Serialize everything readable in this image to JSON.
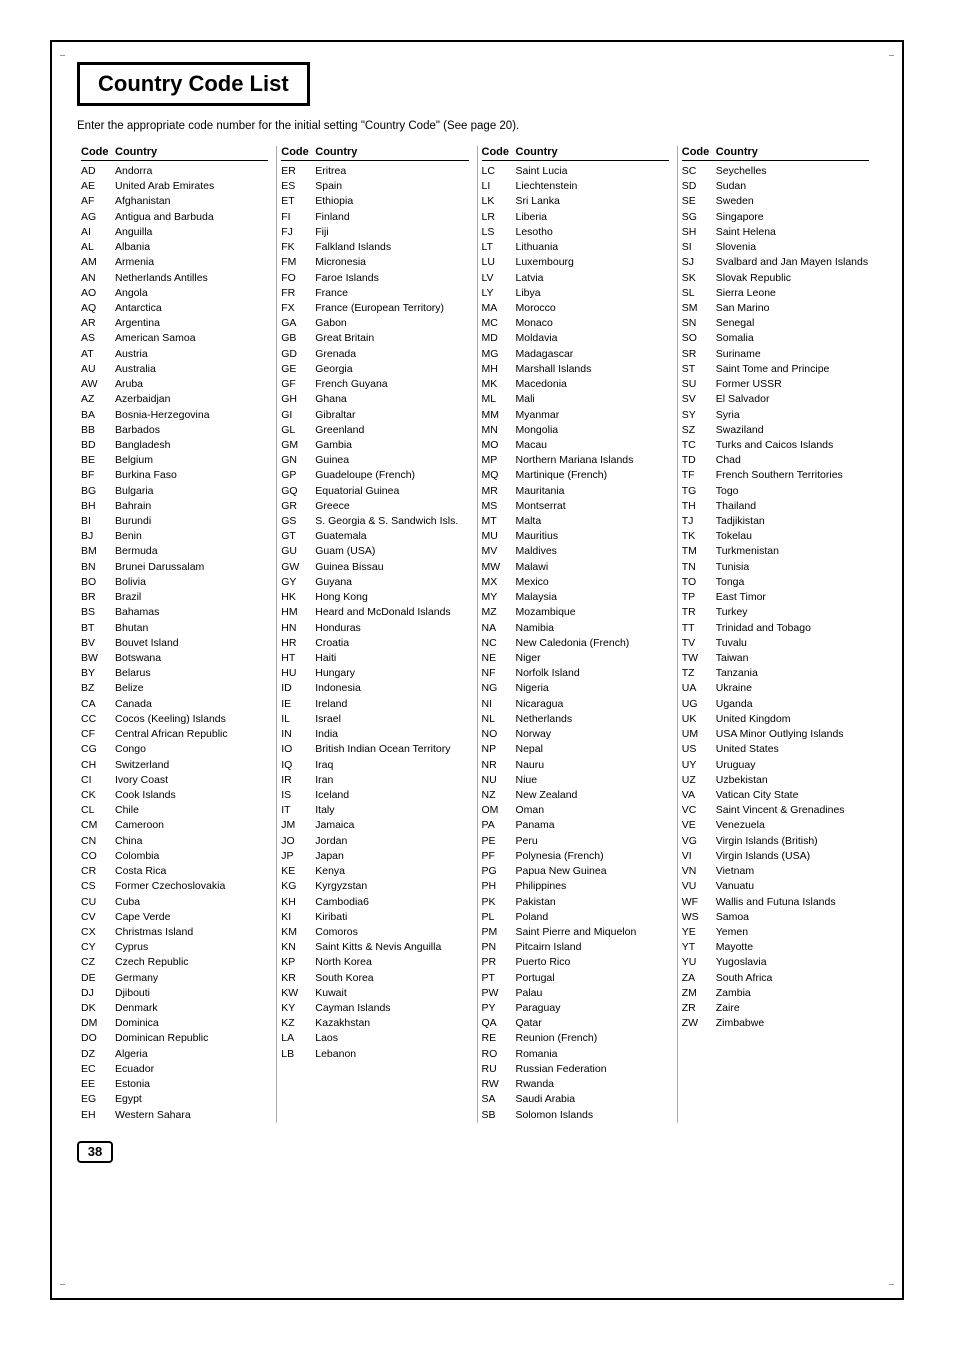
{
  "page": {
    "title": "Country Code List",
    "subtitle": "Enter the appropriate code number for the initial setting \"Country Code\" (See page 20).",
    "page_number": "38",
    "col_header": {
      "code": "Code",
      "country": "Country"
    }
  },
  "columns": [
    {
      "entries": [
        {
          "code": "AD",
          "country": "Andorra"
        },
        {
          "code": "AE",
          "country": "United Arab Emirates"
        },
        {
          "code": "AF",
          "country": "Afghanistan"
        },
        {
          "code": "AG",
          "country": "Antigua and Barbuda"
        },
        {
          "code": "AI",
          "country": "Anguilla"
        },
        {
          "code": "AL",
          "country": "Albania"
        },
        {
          "code": "AM",
          "country": "Armenia"
        },
        {
          "code": "AN",
          "country": "Netherlands Antilles"
        },
        {
          "code": "AO",
          "country": "Angola"
        },
        {
          "code": "AQ",
          "country": "Antarctica"
        },
        {
          "code": "AR",
          "country": "Argentina"
        },
        {
          "code": "AS",
          "country": "American Samoa"
        },
        {
          "code": "AT",
          "country": "Austria"
        },
        {
          "code": "AU",
          "country": "Australia"
        },
        {
          "code": "AW",
          "country": "Aruba"
        },
        {
          "code": "AZ",
          "country": "Azerbaidjan"
        },
        {
          "code": "BA",
          "country": "Bosnia-Herzegovina"
        },
        {
          "code": "BB",
          "country": "Barbados"
        },
        {
          "code": "BD",
          "country": "Bangladesh"
        },
        {
          "code": "BE",
          "country": "Belgium"
        },
        {
          "code": "BF",
          "country": "Burkina Faso"
        },
        {
          "code": "BG",
          "country": "Bulgaria"
        },
        {
          "code": "BH",
          "country": "Bahrain"
        },
        {
          "code": "BI",
          "country": "Burundi"
        },
        {
          "code": "BJ",
          "country": "Benin"
        },
        {
          "code": "BM",
          "country": "Bermuda"
        },
        {
          "code": "BN",
          "country": "Brunei Darussalam"
        },
        {
          "code": "BO",
          "country": "Bolivia"
        },
        {
          "code": "BR",
          "country": "Brazil"
        },
        {
          "code": "BS",
          "country": "Bahamas"
        },
        {
          "code": "BT",
          "country": "Bhutan"
        },
        {
          "code": "BV",
          "country": "Bouvet Island"
        },
        {
          "code": "BW",
          "country": "Botswana"
        },
        {
          "code": "BY",
          "country": "Belarus"
        },
        {
          "code": "BZ",
          "country": "Belize"
        },
        {
          "code": "CA",
          "country": "Canada"
        },
        {
          "code": "CC",
          "country": "Cocos (Keeling) Islands"
        },
        {
          "code": "CF",
          "country": "Central African Republic"
        },
        {
          "code": "CG",
          "country": "Congo"
        },
        {
          "code": "CH",
          "country": "Switzerland"
        },
        {
          "code": "CI",
          "country": "Ivory Coast"
        },
        {
          "code": "CK",
          "country": "Cook Islands"
        },
        {
          "code": "CL",
          "country": "Chile"
        },
        {
          "code": "CM",
          "country": "Cameroon"
        },
        {
          "code": "CN",
          "country": "China"
        },
        {
          "code": "CO",
          "country": "Colombia"
        },
        {
          "code": "CR",
          "country": "Costa Rica"
        },
        {
          "code": "CS",
          "country": "Former Czechoslovakia"
        },
        {
          "code": "CU",
          "country": "Cuba"
        },
        {
          "code": "CV",
          "country": "Cape Verde"
        },
        {
          "code": "CX",
          "country": "Christmas Island"
        },
        {
          "code": "CY",
          "country": "Cyprus"
        },
        {
          "code": "CZ",
          "country": "Czech Republic"
        },
        {
          "code": "DE",
          "country": "Germany"
        },
        {
          "code": "DJ",
          "country": "Djibouti"
        },
        {
          "code": "DK",
          "country": "Denmark"
        },
        {
          "code": "DM",
          "country": "Dominica"
        },
        {
          "code": "DO",
          "country": "Dominican Republic"
        },
        {
          "code": "DZ",
          "country": "Algeria"
        },
        {
          "code": "EC",
          "country": "Ecuador"
        },
        {
          "code": "EE",
          "country": "Estonia"
        },
        {
          "code": "EG",
          "country": "Egypt"
        },
        {
          "code": "EH",
          "country": "Western Sahara"
        }
      ]
    },
    {
      "entries": [
        {
          "code": "ER",
          "country": "Eritrea"
        },
        {
          "code": "ES",
          "country": "Spain"
        },
        {
          "code": "ET",
          "country": "Ethiopia"
        },
        {
          "code": "FI",
          "country": "Finland"
        },
        {
          "code": "FJ",
          "country": "Fiji"
        },
        {
          "code": "FK",
          "country": "Falkland Islands"
        },
        {
          "code": "FM",
          "country": "Micronesia"
        },
        {
          "code": "FO",
          "country": "Faroe Islands"
        },
        {
          "code": "FR",
          "country": "France"
        },
        {
          "code": "FX",
          "country": "France (European Territory)"
        },
        {
          "code": "GA",
          "country": "Gabon"
        },
        {
          "code": "GB",
          "country": "Great Britain"
        },
        {
          "code": "GD",
          "country": "Grenada"
        },
        {
          "code": "GE",
          "country": "Georgia"
        },
        {
          "code": "GF",
          "country": "French Guyana"
        },
        {
          "code": "GH",
          "country": "Ghana"
        },
        {
          "code": "GI",
          "country": "Gibraltar"
        },
        {
          "code": "GL",
          "country": "Greenland"
        },
        {
          "code": "GM",
          "country": "Gambia"
        },
        {
          "code": "GN",
          "country": "Guinea"
        },
        {
          "code": "GP",
          "country": "Guadeloupe (French)"
        },
        {
          "code": "GQ",
          "country": "Equatorial Guinea"
        },
        {
          "code": "GR",
          "country": "Greece"
        },
        {
          "code": "GS",
          "country": "S. Georgia & S. Sandwich Isls."
        },
        {
          "code": "GT",
          "country": "Guatemala"
        },
        {
          "code": "GU",
          "country": "Guam (USA)"
        },
        {
          "code": "GW",
          "country": "Guinea Bissau"
        },
        {
          "code": "GY",
          "country": "Guyana"
        },
        {
          "code": "HK",
          "country": "Hong Kong"
        },
        {
          "code": "HM",
          "country": "Heard and McDonald Islands"
        },
        {
          "code": "HN",
          "country": "Honduras"
        },
        {
          "code": "HR",
          "country": "Croatia"
        },
        {
          "code": "HT",
          "country": "Haiti"
        },
        {
          "code": "HU",
          "country": "Hungary"
        },
        {
          "code": "ID",
          "country": "Indonesia"
        },
        {
          "code": "IE",
          "country": "Ireland"
        },
        {
          "code": "IL",
          "country": "Israel"
        },
        {
          "code": "IN",
          "country": "India"
        },
        {
          "code": "IO",
          "country": "British Indian Ocean Territory"
        },
        {
          "code": "IQ",
          "country": "Iraq"
        },
        {
          "code": "IR",
          "country": "Iran"
        },
        {
          "code": "IS",
          "country": "Iceland"
        },
        {
          "code": "IT",
          "country": "Italy"
        },
        {
          "code": "JM",
          "country": "Jamaica"
        },
        {
          "code": "JO",
          "country": "Jordan"
        },
        {
          "code": "JP",
          "country": "Japan"
        },
        {
          "code": "KE",
          "country": "Kenya"
        },
        {
          "code": "KG",
          "country": "Kyrgyzstan"
        },
        {
          "code": "KH",
          "country": "Cambodia6"
        },
        {
          "code": "KI",
          "country": "Kiribati"
        },
        {
          "code": "KM",
          "country": "Comoros"
        },
        {
          "code": "KN",
          "country": "Saint Kitts & Nevis Anguilla"
        },
        {
          "code": "KP",
          "country": "North Korea"
        },
        {
          "code": "KR",
          "country": "South Korea"
        },
        {
          "code": "KW",
          "country": "Kuwait"
        },
        {
          "code": "KY",
          "country": "Cayman Islands"
        },
        {
          "code": "KZ",
          "country": "Kazakhstan"
        },
        {
          "code": "LA",
          "country": "Laos"
        },
        {
          "code": "LB",
          "country": "Lebanon"
        }
      ]
    },
    {
      "entries": [
        {
          "code": "LC",
          "country": "Saint Lucia"
        },
        {
          "code": "LI",
          "country": "Liechtenstein"
        },
        {
          "code": "LK",
          "country": "Sri Lanka"
        },
        {
          "code": "LR",
          "country": "Liberia"
        },
        {
          "code": "LS",
          "country": "Lesotho"
        },
        {
          "code": "LT",
          "country": "Lithuania"
        },
        {
          "code": "LU",
          "country": "Luxembourg"
        },
        {
          "code": "LV",
          "country": "Latvia"
        },
        {
          "code": "LY",
          "country": "Libya"
        },
        {
          "code": "MA",
          "country": "Morocco"
        },
        {
          "code": "MC",
          "country": "Monaco"
        },
        {
          "code": "MD",
          "country": "Moldavia"
        },
        {
          "code": "MG",
          "country": "Madagascar"
        },
        {
          "code": "MH",
          "country": "Marshall Islands"
        },
        {
          "code": "MK",
          "country": "Macedonia"
        },
        {
          "code": "ML",
          "country": "Mali"
        },
        {
          "code": "MM",
          "country": "Myanmar"
        },
        {
          "code": "MN",
          "country": "Mongolia"
        },
        {
          "code": "MO",
          "country": "Macau"
        },
        {
          "code": "MP",
          "country": "Northern Mariana Islands"
        },
        {
          "code": "MQ",
          "country": "Martinique (French)"
        },
        {
          "code": "MR",
          "country": "Mauritania"
        },
        {
          "code": "MS",
          "country": "Montserrat"
        },
        {
          "code": "MT",
          "country": "Malta"
        },
        {
          "code": "MU",
          "country": "Mauritius"
        },
        {
          "code": "MV",
          "country": "Maldives"
        },
        {
          "code": "MW",
          "country": "Malawi"
        },
        {
          "code": "MX",
          "country": "Mexico"
        },
        {
          "code": "MY",
          "country": "Malaysia"
        },
        {
          "code": "MZ",
          "country": "Mozambique"
        },
        {
          "code": "NA",
          "country": "Namibia"
        },
        {
          "code": "NC",
          "country": "New Caledonia (French)"
        },
        {
          "code": "NE",
          "country": "Niger"
        },
        {
          "code": "NF",
          "country": "Norfolk Island"
        },
        {
          "code": "NG",
          "country": "Nigeria"
        },
        {
          "code": "NI",
          "country": "Nicaragua"
        },
        {
          "code": "NL",
          "country": "Netherlands"
        },
        {
          "code": "NO",
          "country": "Norway"
        },
        {
          "code": "NP",
          "country": "Nepal"
        },
        {
          "code": "NR",
          "country": "Nauru"
        },
        {
          "code": "NU",
          "country": "Niue"
        },
        {
          "code": "NZ",
          "country": "New Zealand"
        },
        {
          "code": "OM",
          "country": "Oman"
        },
        {
          "code": "PA",
          "country": "Panama"
        },
        {
          "code": "PE",
          "country": "Peru"
        },
        {
          "code": "PF",
          "country": "Polynesia (French)"
        },
        {
          "code": "PG",
          "country": "Papua New Guinea"
        },
        {
          "code": "PH",
          "country": "Philippines"
        },
        {
          "code": "PK",
          "country": "Pakistan"
        },
        {
          "code": "PL",
          "country": "Poland"
        },
        {
          "code": "PM",
          "country": "Saint Pierre and Miquelon"
        },
        {
          "code": "PN",
          "country": "Pitcairn Island"
        },
        {
          "code": "PR",
          "country": "Puerto Rico"
        },
        {
          "code": "PT",
          "country": "Portugal"
        },
        {
          "code": "PW",
          "country": "Palau"
        },
        {
          "code": "PY",
          "country": "Paraguay"
        },
        {
          "code": "QA",
          "country": "Qatar"
        },
        {
          "code": "RE",
          "country": "Reunion (French)"
        },
        {
          "code": "RO",
          "country": "Romania"
        },
        {
          "code": "RU",
          "country": "Russian Federation"
        },
        {
          "code": "RW",
          "country": "Rwanda"
        },
        {
          "code": "SA",
          "country": "Saudi Arabia"
        },
        {
          "code": "SB",
          "country": "Solomon Islands"
        }
      ]
    },
    {
      "entries": [
        {
          "code": "SC",
          "country": "Seychelles"
        },
        {
          "code": "SD",
          "country": "Sudan"
        },
        {
          "code": "SE",
          "country": "Sweden"
        },
        {
          "code": "SG",
          "country": "Singapore"
        },
        {
          "code": "SH",
          "country": "Saint Helena"
        },
        {
          "code": "SI",
          "country": "Slovenia"
        },
        {
          "code": "SJ",
          "country": "Svalbard and Jan Mayen Islands"
        },
        {
          "code": "SK",
          "country": "Slovak Republic"
        },
        {
          "code": "SL",
          "country": "Sierra Leone"
        },
        {
          "code": "SM",
          "country": "San Marino"
        },
        {
          "code": "SN",
          "country": "Senegal"
        },
        {
          "code": "SO",
          "country": "Somalia"
        },
        {
          "code": "SR",
          "country": "Suriname"
        },
        {
          "code": "ST",
          "country": "Saint Tome and Principe"
        },
        {
          "code": "SU",
          "country": "Former USSR"
        },
        {
          "code": "SV",
          "country": "El Salvador"
        },
        {
          "code": "SY",
          "country": "Syria"
        },
        {
          "code": "SZ",
          "country": "Swaziland"
        },
        {
          "code": "TC",
          "country": "Turks and Caicos Islands"
        },
        {
          "code": "TD",
          "country": "Chad"
        },
        {
          "code": "TF",
          "country": "French Southern Territories"
        },
        {
          "code": "TG",
          "country": "Togo"
        },
        {
          "code": "TH",
          "country": "Thailand"
        },
        {
          "code": "TJ",
          "country": "Tadjikistan"
        },
        {
          "code": "TK",
          "country": "Tokelau"
        },
        {
          "code": "TM",
          "country": "Turkmenistan"
        },
        {
          "code": "TN",
          "country": "Tunisia"
        },
        {
          "code": "TO",
          "country": "Tonga"
        },
        {
          "code": "TP",
          "country": "East Timor"
        },
        {
          "code": "TR",
          "country": "Turkey"
        },
        {
          "code": "TT",
          "country": "Trinidad and Tobago"
        },
        {
          "code": "TV",
          "country": "Tuvalu"
        },
        {
          "code": "TW",
          "country": "Taiwan"
        },
        {
          "code": "TZ",
          "country": "Tanzania"
        },
        {
          "code": "UA",
          "country": "Ukraine"
        },
        {
          "code": "UG",
          "country": "Uganda"
        },
        {
          "code": "UK",
          "country": "United Kingdom"
        },
        {
          "code": "UM",
          "country": "USA Minor Outlying Islands"
        },
        {
          "code": "US",
          "country": "United States"
        },
        {
          "code": "UY",
          "country": "Uruguay"
        },
        {
          "code": "UZ",
          "country": "Uzbekistan"
        },
        {
          "code": "VA",
          "country": "Vatican City State"
        },
        {
          "code": "VC",
          "country": "Saint Vincent & Grenadines"
        },
        {
          "code": "VE",
          "country": "Venezuela"
        },
        {
          "code": "VG",
          "country": "Virgin Islands (British)"
        },
        {
          "code": "VI",
          "country": "Virgin Islands (USA)"
        },
        {
          "code": "VN",
          "country": "Vietnam"
        },
        {
          "code": "VU",
          "country": "Vanuatu"
        },
        {
          "code": "WF",
          "country": "Wallis and Futuna Islands"
        },
        {
          "code": "WS",
          "country": "Samoa"
        },
        {
          "code": "YE",
          "country": "Yemen"
        },
        {
          "code": "YT",
          "country": "Mayotte"
        },
        {
          "code": "YU",
          "country": "Yugoslavia"
        },
        {
          "code": "ZA",
          "country": "South Africa"
        },
        {
          "code": "ZM",
          "country": "Zambia"
        },
        {
          "code": "ZR",
          "country": "Zaire"
        },
        {
          "code": "ZW",
          "country": "Zimbabwe"
        }
      ]
    }
  ]
}
